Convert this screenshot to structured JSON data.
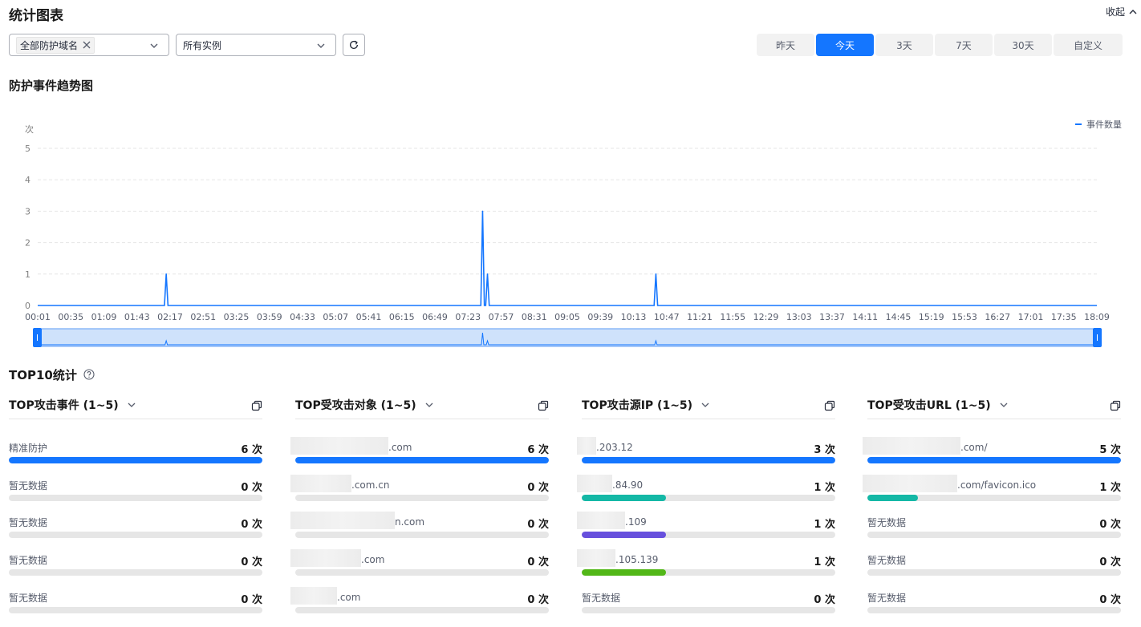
{
  "header": {
    "title": "统计图表",
    "collapse_label": "收起"
  },
  "filters": {
    "domain_tag": "全部防护域名",
    "instance_select": "所有实例"
  },
  "ranges": [
    {
      "label": "昨天",
      "active": false
    },
    {
      "label": "今天",
      "active": true
    },
    {
      "label": "3天",
      "active": false
    },
    {
      "label": "7天",
      "active": false
    },
    {
      "label": "30天",
      "active": false
    },
    {
      "label": "自定义",
      "active": false
    }
  ],
  "trend": {
    "title": "防护事件趋势图"
  },
  "chart_data": {
    "type": "line",
    "ylabel": "次",
    "ylim": [
      0,
      5
    ],
    "yticks": [
      0,
      1,
      2,
      3,
      4,
      5
    ],
    "x_ticks": [
      "00:01",
      "00:35",
      "01:09",
      "01:43",
      "02:17",
      "02:51",
      "03:25",
      "03:59",
      "04:33",
      "05:07",
      "05:41",
      "06:15",
      "06:49",
      "07:23",
      "07:57",
      "08:31",
      "09:05",
      "09:39",
      "10:13",
      "10:47",
      "11:21",
      "11:55",
      "12:29",
      "13:03",
      "13:37",
      "14:11",
      "14:45",
      "15:19",
      "15:53",
      "16:27",
      "17:01",
      "17:35",
      "18:09"
    ],
    "grid": true,
    "legend_position": "top-right",
    "series": [
      {
        "name": "事件数量",
        "color": "#1476ff",
        "points": [
          {
            "x": "00:01",
            "y": 0
          },
          {
            "x": "02:13",
            "y": 1
          },
          {
            "x": "07:38",
            "y": 3
          },
          {
            "x": "07:43",
            "y": 1
          },
          {
            "x": "10:36",
            "y": 1
          },
          {
            "x": "18:09",
            "y": 0
          }
        ]
      }
    ]
  },
  "top10": {
    "title": "TOP10统计",
    "cards": [
      {
        "title": "TOP攻击事件 (1~5)",
        "rows": [
          {
            "label": "精准防护",
            "count": "6 次",
            "value": 6,
            "color": "#1476ff"
          },
          {
            "label": "暂无数据",
            "count": "0 次",
            "value": 0,
            "color": "#e6e6e6"
          },
          {
            "label": "暂无数据",
            "count": "0 次",
            "value": 0,
            "color": "#e6e6e6"
          },
          {
            "label": "暂无数据",
            "count": "0 次",
            "value": 0,
            "color": "#e6e6e6"
          },
          {
            "label": "暂无数据",
            "count": "0 次",
            "value": 0,
            "color": "#e6e6e6"
          }
        ]
      },
      {
        "title": "TOP受攻击对象 (1~5)",
        "rows": [
          {
            "label": ".com",
            "count": "6 次",
            "value": 6,
            "color": "#1476ff",
            "mask": 122
          },
          {
            "label": ".com.cn",
            "count": "0 次",
            "value": 0,
            "color": "#e6e6e6",
            "mask": 76
          },
          {
            "label": "n.com",
            "count": "0 次",
            "value": 0,
            "color": "#e6e6e6",
            "mask": 130
          },
          {
            "label": ".com",
            "count": "0 次",
            "value": 0,
            "color": "#e6e6e6",
            "mask": 88
          },
          {
            "label": ".com",
            "count": "0 次",
            "value": 0,
            "color": "#e6e6e6",
            "mask": 58
          }
        ]
      },
      {
        "title": "TOP攻击源IP (1~5)",
        "rows": [
          {
            "label": ".203.12",
            "count": "3 次",
            "value": 3,
            "color": "#1476ff",
            "mask": 24
          },
          {
            "label": ".84.90",
            "count": "1 次",
            "value": 1,
            "color": "#14b8a6",
            "mask": 44
          },
          {
            "label": ".109",
            "count": "1 次",
            "value": 1,
            "color": "#6750dd",
            "mask": 60
          },
          {
            "label": ".105.139",
            "count": "1 次",
            "value": 1,
            "color": "#52b718",
            "mask": 48
          },
          {
            "label": "暂无数据",
            "count": "0 次",
            "value": 0,
            "color": "#e6e6e6"
          }
        ]
      },
      {
        "title": "TOP受攻击URL (1~5)",
        "rows": [
          {
            "label": ".com/",
            "count": "5 次",
            "value": 5,
            "color": "#1476ff",
            "mask": 122
          },
          {
            "label": ".com/favicon.ico",
            "count": "1 次",
            "value": 1,
            "color": "#14b8a6",
            "mask": 118
          },
          {
            "label": "暂无数据",
            "count": "0 次",
            "value": 0,
            "color": "#e6e6e6"
          },
          {
            "label": "暂无数据",
            "count": "0 次",
            "value": 0,
            "color": "#e6e6e6"
          },
          {
            "label": "暂无数据",
            "count": "0 次",
            "value": 0,
            "color": "#e6e6e6"
          }
        ]
      }
    ]
  }
}
